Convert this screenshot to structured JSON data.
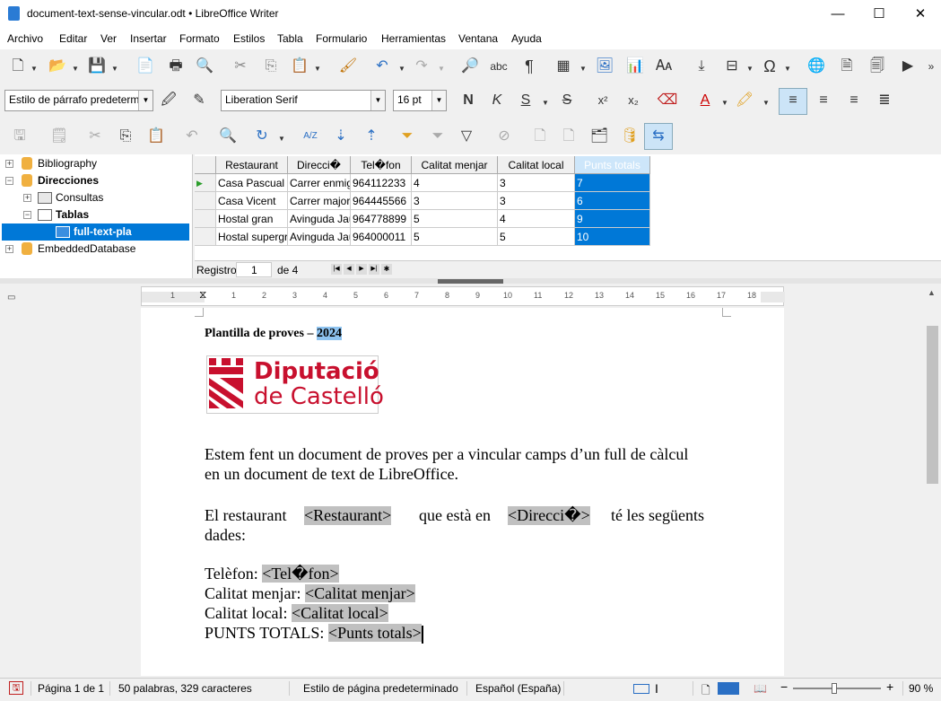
{
  "window": {
    "title": "document-text-sense-vincular.odt • LibreOffice Writer",
    "minimize": "—",
    "maximize": "☐",
    "close": "✕"
  },
  "menu": [
    "Archivo",
    "Editar",
    "Ver",
    "Insertar",
    "Formato",
    "Estilos",
    "Tabla",
    "Formulario",
    "Herramientas",
    "Ventana",
    "Ayuda"
  ],
  "format": {
    "paragraph_style": "Estilo de párrafo predetermin",
    "font_name": "Liberation Serif",
    "font_size": "16 pt",
    "bold": "N",
    "italic": "K",
    "underline": "S",
    "strike": "S",
    "superscript": "x²",
    "subscript": "x₂"
  },
  "tree": {
    "items": [
      {
        "label": "Bibliography"
      },
      {
        "label": "Direcciones"
      },
      {
        "label": "Consultas"
      },
      {
        "label": "Tablas"
      },
      {
        "label": "full-text-pla"
      },
      {
        "label": "EmbeddedDatabase"
      }
    ]
  },
  "grid": {
    "columns": [
      "Restaurant",
      "Direcci�",
      "Tel�fon",
      "Calitat menjar",
      "Calitat local",
      "Punts totals"
    ],
    "rows": [
      [
        "Casa Pascual",
        "Carrer enmig",
        "964112233",
        "4",
        "3",
        "7"
      ],
      [
        "Casa Vicent",
        "Carrer major",
        "964445566",
        "3",
        "3",
        "6"
      ],
      [
        "Hostal gran",
        "Avinguda Jau",
        "964778899",
        "5",
        "4",
        "9"
      ],
      [
        "Hostal supergr",
        "Avinguda Jau",
        "964000011",
        "5",
        "5",
        "10"
      ]
    ],
    "nav": {
      "label": "Registro",
      "current": "1",
      "of": "de 4"
    }
  },
  "ruler": {
    "ticks": [
      "1",
      "1",
      "2",
      "3",
      "4",
      "5",
      "6",
      "7",
      "8",
      "9",
      "10",
      "11",
      "12",
      "13",
      "14",
      "15",
      "16",
      "17",
      "18"
    ]
  },
  "document": {
    "heading": "Plantilla de proves –",
    "heading_year": "2024",
    "logo_line1": "Diputació",
    "logo_line2": "de Castelló",
    "para1_line1": "Estem fent un document de proves per a vincular camps d’un full de càlcul",
    "para1_line2": "en un document de text de LibreOffice.",
    "p2_a": "El restaurant",
    "p2_field1": "<Restaurant>",
    "p2_b": "que està en",
    "p2_field2": "<Direcci�>",
    "p2_c": "té les següents",
    "p2_line2": "dades:",
    "l1_label": "Telèfon:",
    "l1_field": "<Tel�fon>",
    "l2_label": "Calitat menjar:",
    "l2_field": "<Calitat menjar>",
    "l3_label": "Calitat local:",
    "l3_field": "<Calitat local>",
    "l4_label": "PUNTS TOTALS:",
    "l4_field": "<Punts totals>"
  },
  "status": {
    "page": "Página 1 de 1",
    "words": "50 palabras, 329 caracteres",
    "page_style": "Estilo de página predeterminado",
    "language": "Español (España)",
    "zoom": "90 %"
  },
  "colors": {
    "selection": "#0078d7",
    "field_bg": "#c0c0c0",
    "logo_red": "#c8102e"
  }
}
